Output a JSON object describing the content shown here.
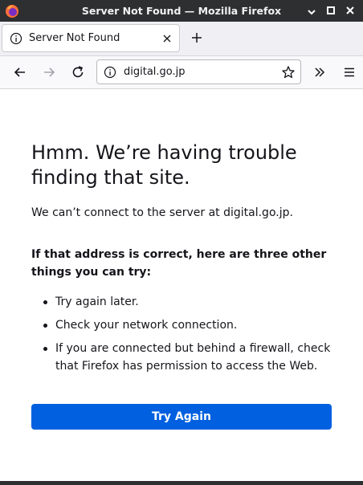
{
  "window": {
    "title": "Server Not Found — Mozilla Firefox",
    "icon": "firefox-logo",
    "controls": [
      "minimize-icon",
      "maximize-icon",
      "close-icon"
    ]
  },
  "tabs": [
    {
      "label": "Server Not Found",
      "icon": "info-icon",
      "active": true
    }
  ],
  "toolbar": {
    "url": "digital.go.jp",
    "buttons": [
      "back-icon",
      "forward-icon",
      "reload-icon",
      "bookmark-star-icon",
      "overflow-chevron-icon",
      "hamburger-menu-icon"
    ]
  },
  "page": {
    "heading": "Hmm. We’re having trouble finding that site.",
    "description": "We can’t connect to the server at digital.go.jp.",
    "advice_title": "If that address is correct, here are three other things you can try:",
    "tips": [
      "Try again later.",
      "Check your network connection.",
      "If you are connected but behind a firewall, check that Firefox has permission to access the Web."
    ],
    "try_again_label": "Try Again"
  },
  "colors": {
    "titlebar": "#2e2f31",
    "primary_button": "#0060df",
    "text": "#15141a"
  }
}
